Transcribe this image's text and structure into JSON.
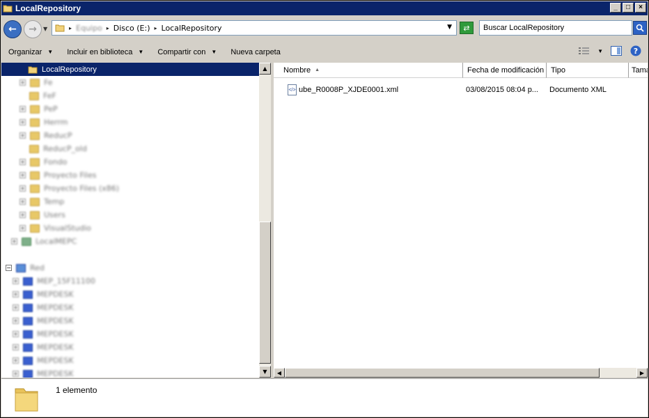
{
  "window": {
    "title": "LocalRepository",
    "controls": {
      "minimize": "_",
      "maximize": "□",
      "close": "×"
    }
  },
  "address_bar": {
    "blurred_root": "Equipo",
    "crumbs": [
      "Disco (E:)",
      "LocalRepository"
    ],
    "search_placeholder": "Buscar LocalRepository"
  },
  "toolbar": {
    "organize": "Organizar",
    "include_library": "Incluir en biblioteca",
    "share_with": "Compartir con",
    "new_folder": "Nueva carpeta"
  },
  "tree": {
    "selected": "LocalRepository",
    "blurred_items": [
      "Fe",
      "FeF",
      "PeP",
      "Herrm",
      "ReducP",
      "ReducP_old",
      "Fondo",
      "Proyecto Files",
      "Proyecto Files (x86)",
      "Temp",
      "Users",
      "VisualStudio",
      "LocalMEPC",
      "Red",
      "MEP_15F11100",
      "MEPDESK",
      "MEPDESK",
      "MEPDESK",
      "MEPDESK",
      "MEPDESK",
      "MEPDESK",
      "MEPDESK"
    ]
  },
  "file_list": {
    "columns": [
      "Nombre",
      "Fecha de modificación",
      "Tipo",
      "Tamaño"
    ],
    "rows": [
      {
        "name": "ube_R0008P_XJDE0001.xml",
        "modified": "03/08/2015 08:04 p...",
        "type": "Documento XML",
        "size": ""
      }
    ]
  },
  "details": {
    "count": "1 elemento"
  },
  "colors": {
    "selection": "#0a246a",
    "chrome": "#d4d0c8",
    "accent": "#3b6fc2"
  }
}
